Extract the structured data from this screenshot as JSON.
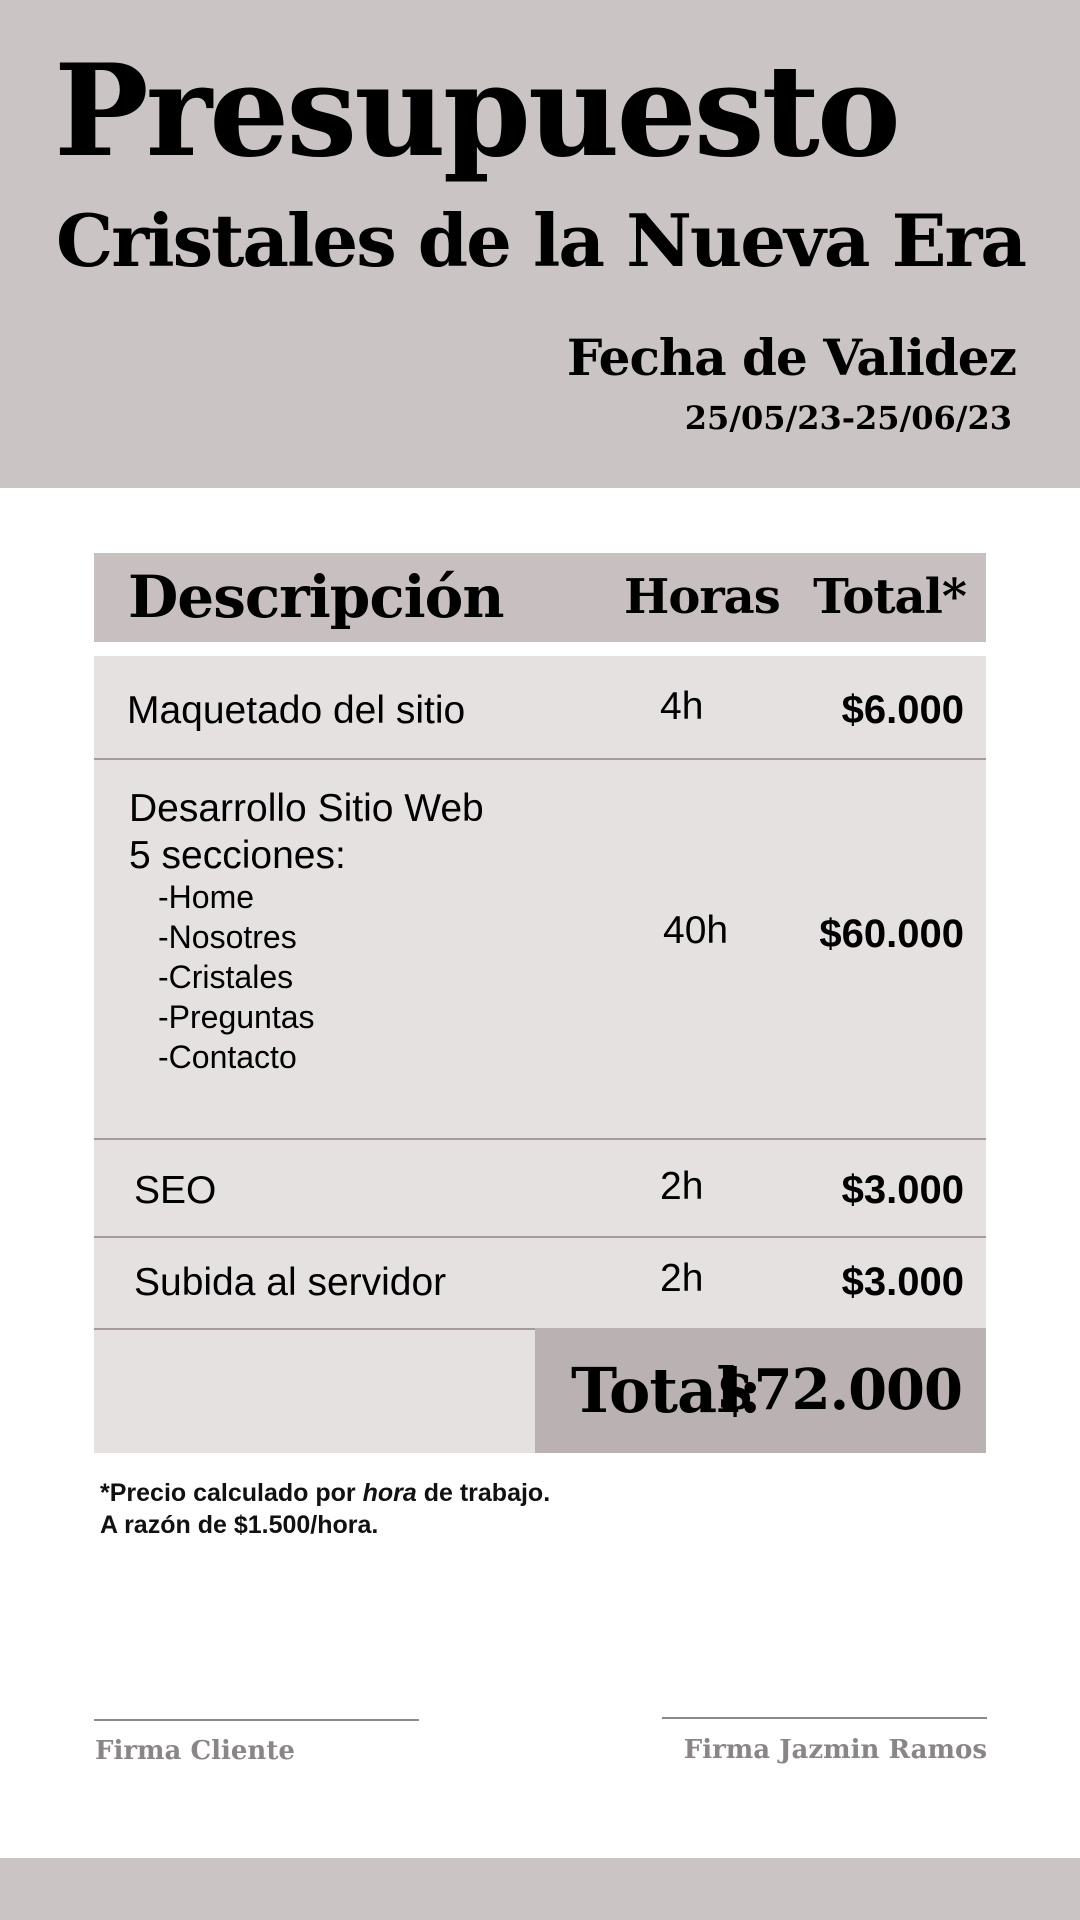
{
  "header": {
    "title": "Presupuesto",
    "subtitle": "Cristales de la Nueva Era",
    "validity_label": "Fecha de Validez",
    "validity_dates": "25/05/23-25/06/23"
  },
  "table": {
    "headers": {
      "description": "Descripción",
      "hours": "Horas",
      "total": "Total*"
    },
    "rows": [
      {
        "description": "Maquetado del sitio",
        "hours": "4h",
        "total": "$6.000"
      },
      {
        "description_line1": "Desarrollo Sitio Web",
        "description_line2": "5 secciones:",
        "sub_items": [
          "-Home",
          "-Nosotres",
          "-Cristales",
          "-Preguntas",
          "-Contacto"
        ],
        "hours": "40h",
        "total": "$60.000"
      },
      {
        "description": "SEO",
        "hours": "2h",
        "total": "$3.000"
      },
      {
        "description": "Subida al servidor",
        "hours": "2h",
        "total": "$3.000"
      }
    ],
    "total_label": "Total:",
    "total_value": "$72.000"
  },
  "note": {
    "line1_prefix": "*Precio calculado por ",
    "line1_emphasis": "hora",
    "line1_suffix": " de trabajo.",
    "line2_prefix": "A razón de ",
    "line2_rate": "$1.500/hora."
  },
  "signatures": {
    "client": "Firma Cliente",
    "provider": "Firma Jazmin Ramos"
  }
}
